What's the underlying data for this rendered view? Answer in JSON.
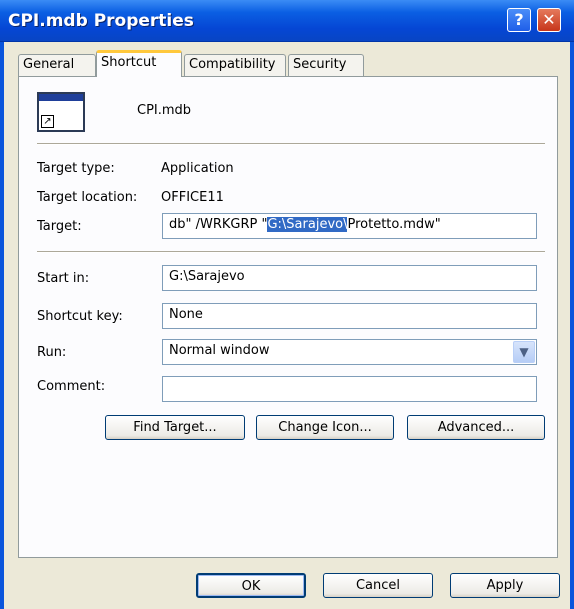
{
  "window": {
    "title": "CPI.mdb Properties",
    "help_icon": "help-question-icon",
    "close_icon": "close-x-icon"
  },
  "tabs": [
    {
      "label": "General"
    },
    {
      "label": "Shortcut"
    },
    {
      "label": "Compatibility"
    },
    {
      "label": "Security"
    }
  ],
  "shortcut": {
    "icon": "shortcut-file-icon",
    "file_name": "CPI.mdb",
    "target_type_label": "Target type:",
    "target_type_value": "Application",
    "target_location_label": "Target location:",
    "target_location_value": "OFFICE11",
    "target_label": "Target:",
    "target_value_before": "db\" /WRKGRP \"",
    "target_value_selected": "G:\\Sarajevo\\",
    "target_value_after": "Protetto.mdw\"",
    "start_in_label": "Start in:",
    "start_in_value": "G:\\Sarajevo",
    "shortcut_key_label": "Shortcut key:",
    "shortcut_key_value": "None",
    "run_label": "Run:",
    "run_value": "Normal window",
    "comment_label": "Comment:",
    "comment_value": "",
    "find_target_label": "Find Target...",
    "change_icon_label": "Change Icon...",
    "advanced_label": "Advanced..."
  },
  "footer": {
    "ok_label": "OK",
    "cancel_label": "Cancel",
    "apply_label": "Apply"
  },
  "colors": {
    "title_bar": "#0b5fe3",
    "dialog_bg": "#ece9d8",
    "selection": "#316ac5",
    "active_tab_accent": "#ffc83c"
  }
}
